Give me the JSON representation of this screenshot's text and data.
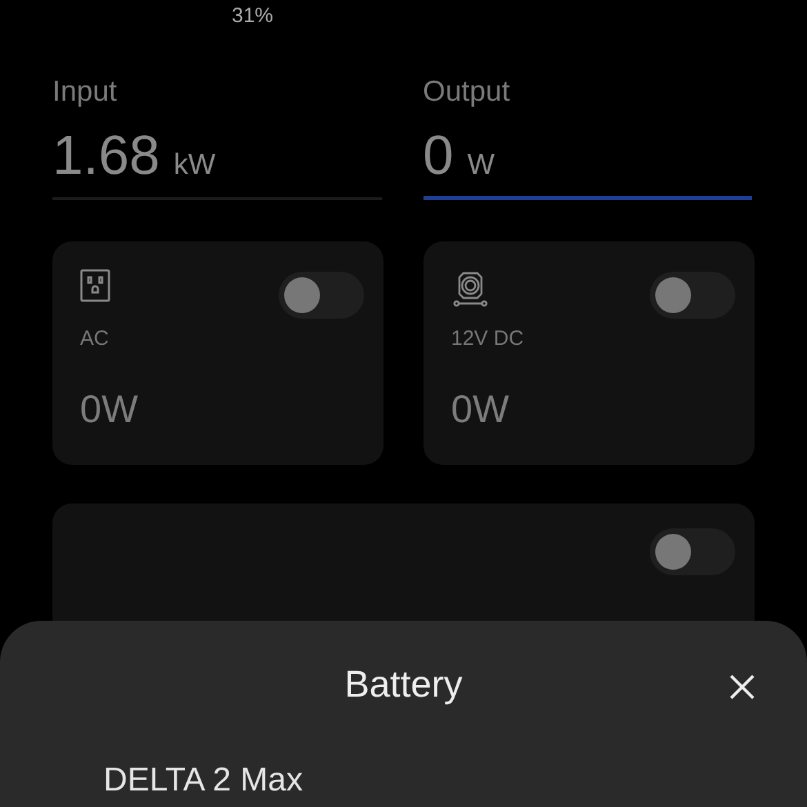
{
  "battery": {
    "percent": "31%"
  },
  "tabs": [
    {
      "label": "Input",
      "value": "1.68",
      "unit": "kW",
      "selected": false
    },
    {
      "label": "Output",
      "value": "0",
      "unit": "W",
      "selected": true
    }
  ],
  "outputs": [
    {
      "kind": "ac",
      "label": "AC",
      "power": "0W",
      "on": false
    },
    {
      "kind": "dc",
      "label": "12V DC",
      "power": "0W",
      "on": false
    },
    {
      "kind": "other",
      "on": false
    }
  ],
  "sheet": {
    "title": "Battery",
    "device": "DELTA 2 Max"
  }
}
